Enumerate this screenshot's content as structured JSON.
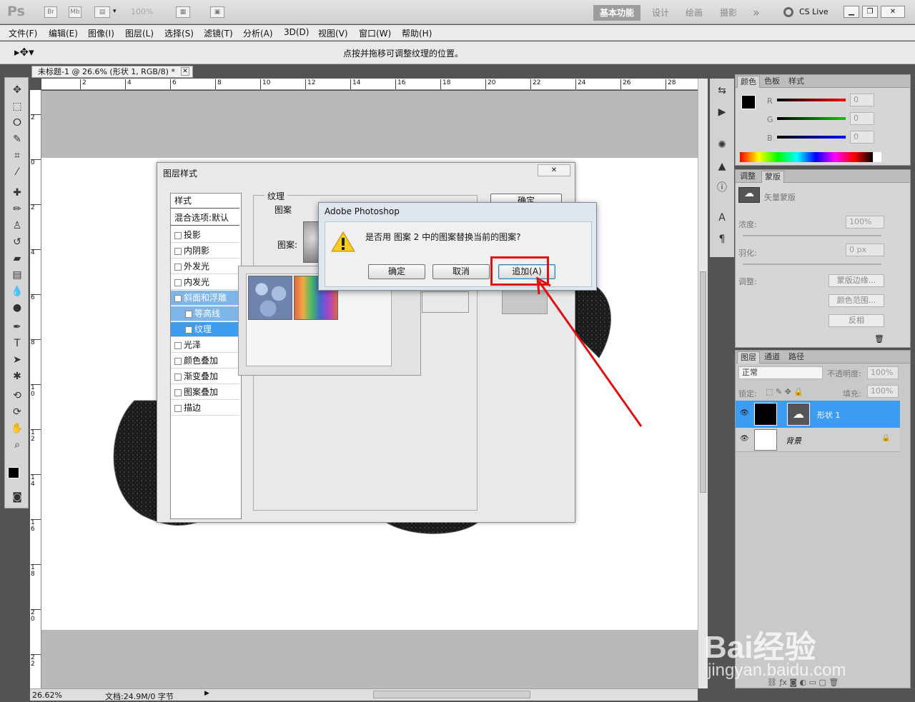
{
  "app": {
    "logo": "Ps",
    "zoom_combo": "100%",
    "workspaces": [
      "基本功能",
      "设计",
      "绘画",
      "摄影"
    ],
    "more": "»",
    "cslive": "CS Live"
  },
  "menu": [
    "文件(F)",
    "编辑(E)",
    "图像(I)",
    "图层(L)",
    "选择(S)",
    "滤镜(T)",
    "分析(A)",
    "3D(D)",
    "视图(V)",
    "窗口(W)",
    "帮助(H)"
  ],
  "options": {
    "hint": "点按并拖移可调整纹理的位置。"
  },
  "document": {
    "tab_title": "未标题-1 @ 26.6% (形状 1, RGB/8) *",
    "ruler_top": [
      "2",
      "4",
      "6",
      "8",
      "10",
      "12",
      "14",
      "16",
      "18",
      "20",
      "22",
      "24",
      "26",
      "28"
    ],
    "ruler_left": [
      "2",
      "0",
      "2",
      "4",
      "6",
      "8",
      "1\n0",
      "1\n2",
      "1\n4",
      "1\n6",
      "1\n8",
      "2\n0",
      "2\n2"
    ]
  },
  "status": {
    "zoom": "26.62%",
    "doc": "文档:24.9M/0 字节"
  },
  "color_panel": {
    "tabs": [
      "颜色",
      "色板",
      "样式"
    ],
    "channels": [
      {
        "label": "R",
        "value": "0"
      },
      {
        "label": "G",
        "value": "0"
      },
      {
        "label": "B",
        "value": "0"
      }
    ]
  },
  "mask_panel": {
    "tabs": [
      "调整",
      "蒙版"
    ],
    "mask_type": "矢量蒙版",
    "density_label": "浓度:",
    "density": "100%",
    "feather_label": "羽化:",
    "feather": "0 px",
    "refine_label": "调整:",
    "buttons": [
      "蒙版边缘...",
      "颜色范围...",
      "反相"
    ]
  },
  "layers_panel": {
    "tabs": [
      "图层",
      "通道",
      "路径"
    ],
    "blend": "正常",
    "opacity_label": "不透明度:",
    "opacity": "100%",
    "lock_label": "锁定:",
    "fill_label": "填充:",
    "fill": "100%",
    "layers": [
      {
        "name": "形状 1",
        "selected": true
      },
      {
        "name": "背景",
        "selected": false
      }
    ]
  },
  "layer_style": {
    "title": "图层样式",
    "styles_header": "样式",
    "blend_options": "混合选项:默认",
    "items": [
      {
        "label": "投影",
        "checked": false
      },
      {
        "label": "内阴影",
        "checked": false
      },
      {
        "label": "外发光",
        "checked": false
      },
      {
        "label": "内发光",
        "checked": false
      },
      {
        "label": "斜面和浮雕",
        "checked": true
      },
      {
        "label": "等高线",
        "checked": false
      },
      {
        "label": "纹理",
        "checked": true
      },
      {
        "label": "光泽",
        "checked": false
      },
      {
        "label": "颜色叠加",
        "checked": false
      },
      {
        "label": "渐变叠加",
        "checked": false
      },
      {
        "label": "图案叠加",
        "checked": false
      },
      {
        "label": "描边",
        "checked": false
      }
    ],
    "group_title": "纹理",
    "sub_group": "图案",
    "pattern_label": "图案:",
    "ok": "确定"
  },
  "alert": {
    "title": "Adobe Photoshop",
    "message": "是否用 图案 2 中的图案替换当前的图案?",
    "buttons": {
      "ok": "确定",
      "cancel": "取消",
      "append": "追加(A)"
    }
  },
  "watermark": {
    "brand": "Bai经验",
    "url": "jingyan.baidu.com"
  }
}
